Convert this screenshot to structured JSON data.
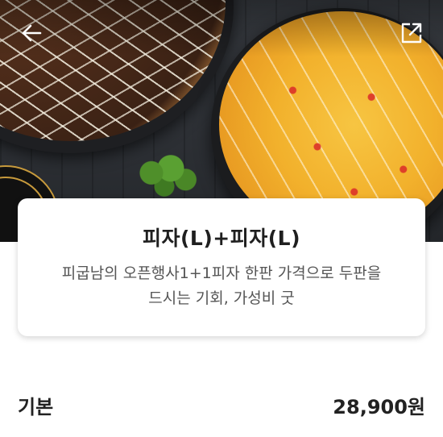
{
  "header": {
    "back_icon": "arrow-left-icon",
    "share_icon": "share-external-icon"
  },
  "product": {
    "name": "피자(L)+피자(L)",
    "description_line1": "피굽남의 오픈행사1+1피자 한판 가격으로 두판을",
    "description_line2": "드시는 기회, 가성비 굿"
  },
  "option": {
    "label": "기본",
    "price": "28,900원"
  },
  "colors": {
    "text_primary": "#1f1f1f",
    "text_secondary": "#555555",
    "card_background": "#ffffff"
  }
}
